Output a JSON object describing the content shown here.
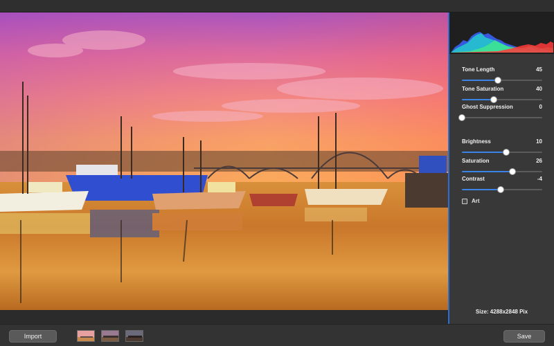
{
  "panel": {
    "controls": [
      {
        "label": "Tone Length",
        "value": "45",
        "level": 0.45
      },
      {
        "label": "Tone Saturation",
        "value": "40",
        "level": 0.4
      },
      {
        "label": "Ghost Suppression",
        "value": "0",
        "level": 0.0
      },
      {
        "label": "Brightness",
        "value": "10",
        "level": 0.55
      },
      {
        "label": "Saturation",
        "value": "26",
        "level": 0.63
      },
      {
        "label": "Contrast",
        "value": "-4",
        "level": 0.48
      }
    ],
    "art_label": "Art",
    "art_checked": false,
    "size_info": "Size: 4288x2848 Pix"
  },
  "toolbar": {
    "import_label": "Import",
    "save_label": "Save"
  },
  "colors": {
    "accent": "#3a84e8",
    "panel_bg": "#383838",
    "bar_bg": "#333333"
  }
}
